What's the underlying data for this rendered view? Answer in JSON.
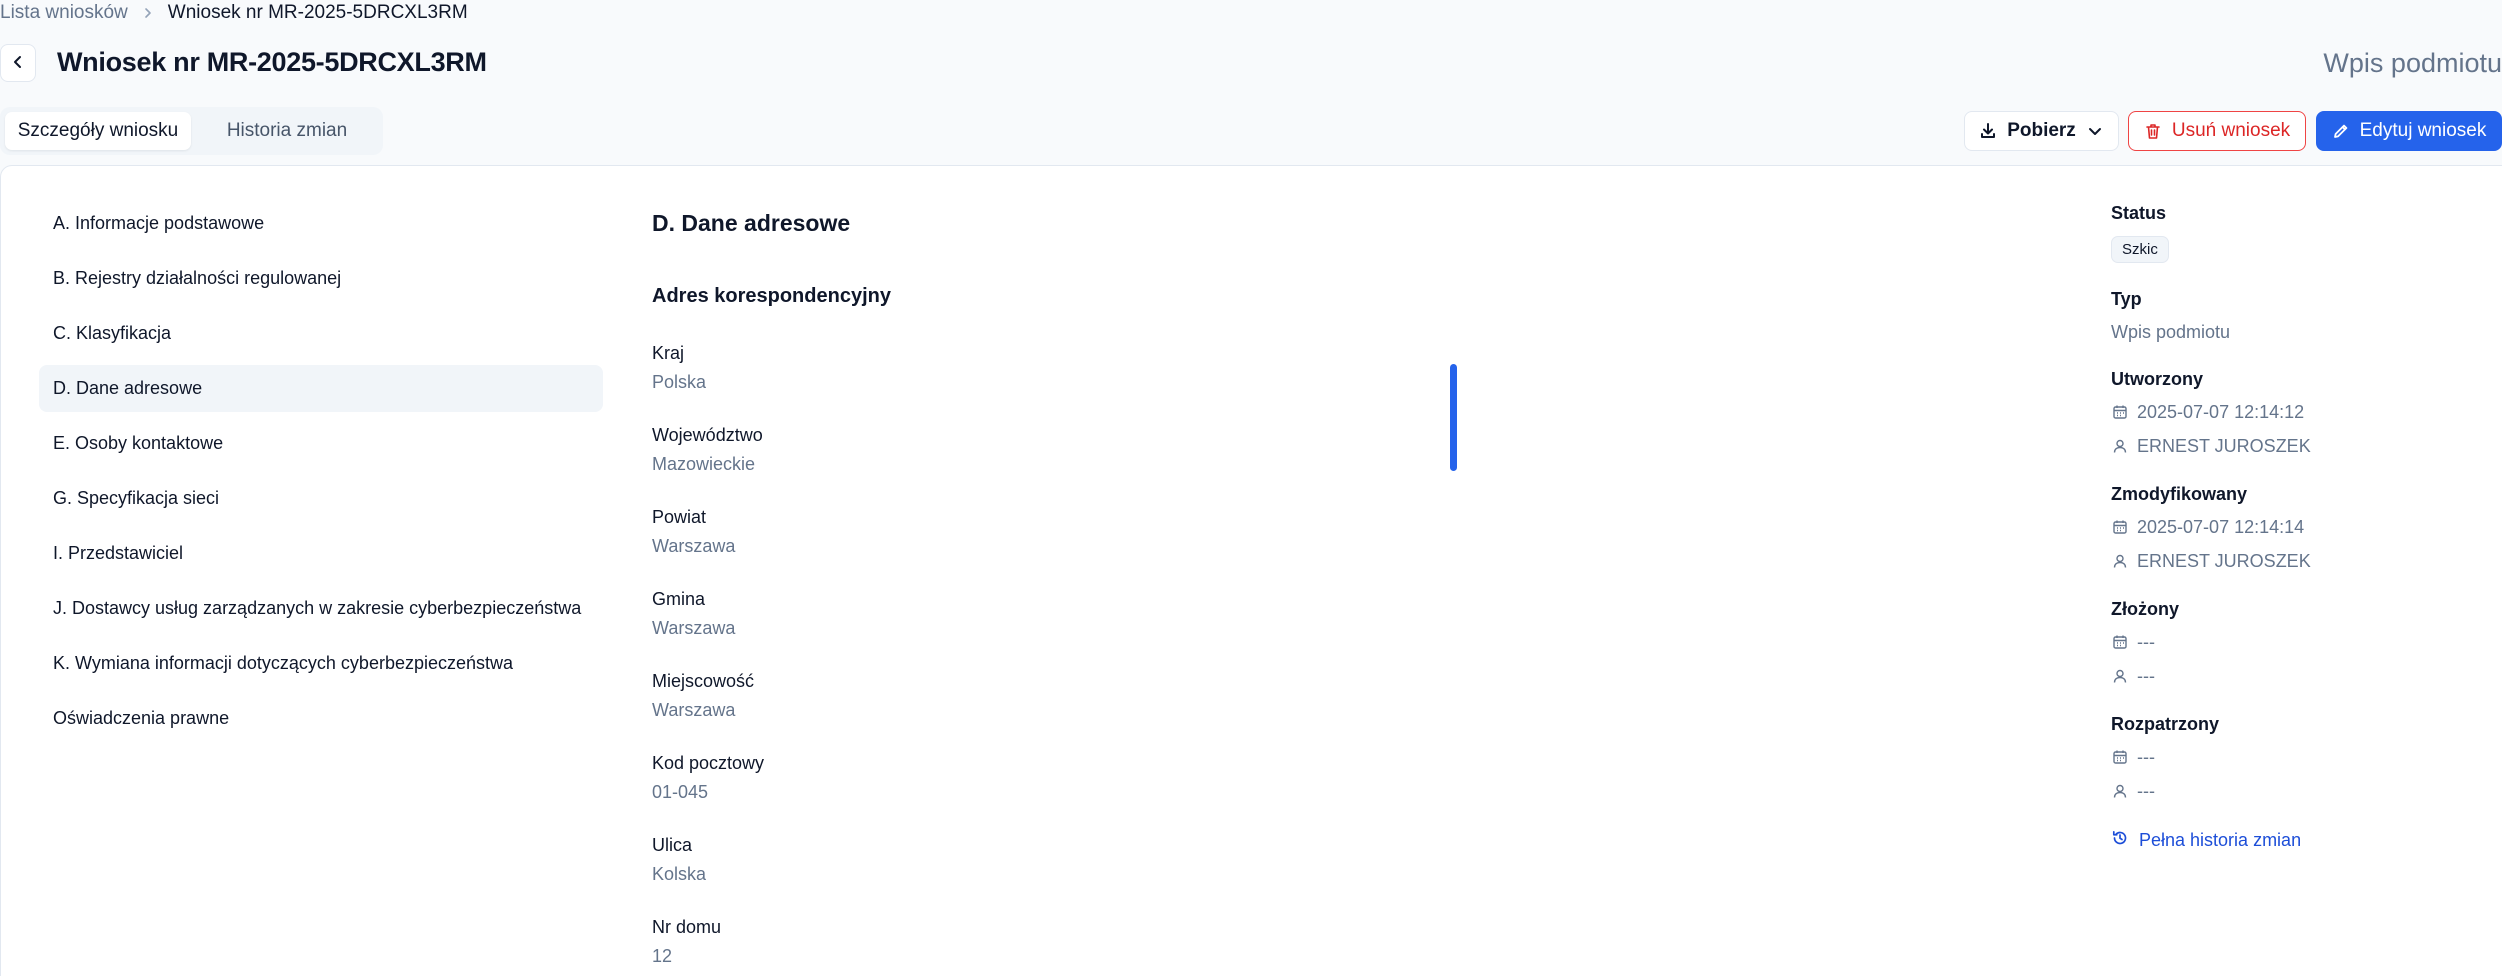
{
  "breadcrumb": {
    "parent": "Lista wniosków",
    "current": "Wniosek nr MR-2025-5DRCXL3RM"
  },
  "header": {
    "title": "Wniosek nr MR-2025-5DRCXL3RM",
    "type": "Wpis podmiotu"
  },
  "tabs": [
    {
      "label": "Szczegóły wniosku",
      "active": true
    },
    {
      "label": "Historia zmian",
      "active": false
    }
  ],
  "actions": {
    "download": "Pobierz",
    "delete": "Usuń wniosek",
    "edit": "Edytuj wniosek"
  },
  "sections": [
    "A. Informacje podstawowe",
    "B. Rejestry działalności regulowanej",
    "C. Klasyfikacja",
    "D. Dane adresowe",
    "E. Osoby kontaktowe",
    "G. Specyfikacja sieci",
    "I. Przedstawiciel",
    "J. Dostawcy usług zarządzanych w zakresie cyberbezpieczeństwa",
    "K. Wymiana informacji dotyczących cyberbezpieczeństwa",
    "Oświadczenia prawne"
  ],
  "content": {
    "section_title": "D. Dane adresowe",
    "subsection_title": "Adres korespondencyjny",
    "fields": [
      {
        "label": "Kraj",
        "value": "Polska"
      },
      {
        "label": "Województwo",
        "value": "Mazowieckie"
      },
      {
        "label": "Powiat",
        "value": "Warszawa"
      },
      {
        "label": "Gmina",
        "value": "Warszawa"
      },
      {
        "label": "Miejscowość",
        "value": "Warszawa"
      },
      {
        "label": "Kod pocztowy",
        "value": "01-045"
      },
      {
        "label": "Ulica",
        "value": "Kolska"
      },
      {
        "label": "Nr domu",
        "value": "12"
      }
    ]
  },
  "side": {
    "status_label": "Status",
    "status_value": "Szkic",
    "type_label": "Typ",
    "type_value": "Wpis podmiotu",
    "created_label": "Utworzony",
    "created_date": "2025-07-07 12:14:12",
    "created_user": "ERNEST JUROSZEK",
    "modified_label": "Zmodyfikowany",
    "modified_date": "2025-07-07 12:14:14",
    "modified_user": "ERNEST JUROSZEK",
    "submitted_label": "Złożony",
    "submitted_date": "---",
    "submitted_user": "---",
    "reviewed_label": "Rozpatrzony",
    "reviewed_date": "---",
    "reviewed_user": "---",
    "history_link": "Pełna historia zmian"
  },
  "colors": {
    "accent": "#2563eb",
    "danger": "#dc2626",
    "muted": "#64748b"
  },
  "icons": [
    "chevron-right-icon",
    "chevron-left-icon",
    "download-icon",
    "chevron-down-icon",
    "trash-icon",
    "pencil-icon",
    "calendar-icon",
    "user-icon",
    "history-icon"
  ]
}
